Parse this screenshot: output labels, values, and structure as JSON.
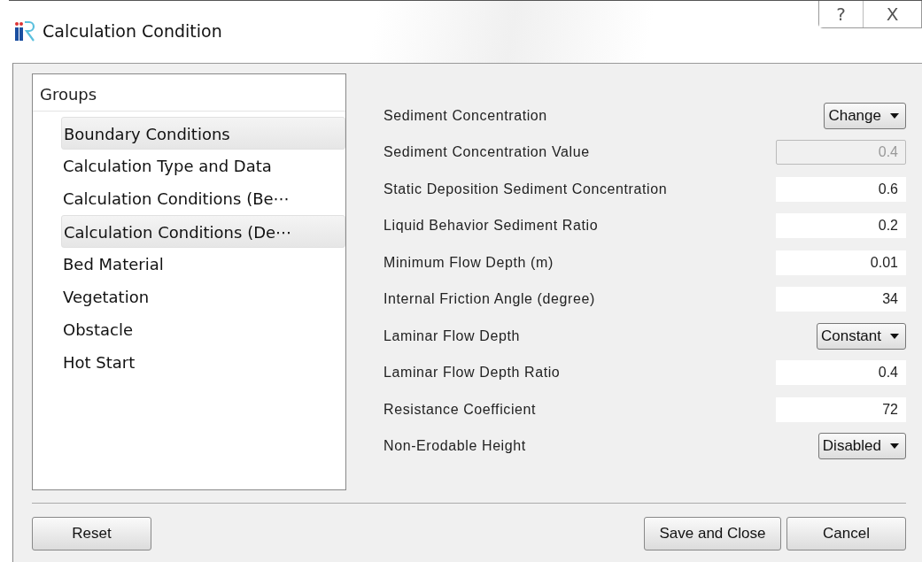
{
  "window": {
    "title": "Calculation Condition",
    "help_button": "?",
    "close_button": "X"
  },
  "groups": {
    "header": "Groups",
    "items": [
      {
        "label": "Boundary Conditions",
        "selected": true
      },
      {
        "label": "Calculation Type and Data",
        "selected": false
      },
      {
        "label": "Calculation Conditions (Be⋯",
        "selected": false
      },
      {
        "label": "Calculation Conditions (De⋯",
        "selected": true
      },
      {
        "label": "Bed Material",
        "selected": false
      },
      {
        "label": "Vegetation",
        "selected": false
      },
      {
        "label": "Obstacle",
        "selected": false
      },
      {
        "label": "Hot Start",
        "selected": false
      }
    ]
  },
  "conditions": [
    {
      "kind": "select",
      "label": "Sediment Concentration",
      "value": "Change"
    },
    {
      "kind": "field",
      "label": "Sediment Concentration Value",
      "value": "0.4",
      "disabled": true
    },
    {
      "kind": "field",
      "label": "Static Deposition Sediment Concentration",
      "value": "0.6",
      "disabled": false
    },
    {
      "kind": "field",
      "label": "Liquid Behavior Sediment Ratio",
      "value": "0.2",
      "disabled": false
    },
    {
      "kind": "field",
      "label": "Minimum Flow Depth (m)",
      "value": "0.01",
      "disabled": false
    },
    {
      "kind": "field",
      "label": "Internal Friction Angle (degree)",
      "value": "34",
      "disabled": false
    },
    {
      "kind": "select",
      "label": "Laminar Flow Depth",
      "value": "Constant"
    },
    {
      "kind": "field",
      "label": "Laminar Flow Depth Ratio",
      "value": "0.4",
      "disabled": false
    },
    {
      "kind": "field",
      "label": "Resistance Coefficient",
      "value": "72",
      "disabled": false
    },
    {
      "kind": "select",
      "label": "Non-Erodable Height",
      "value": "Disabled"
    }
  ],
  "buttons": {
    "reset": "Reset",
    "save": "Save and Close",
    "cancel": "Cancel"
  }
}
